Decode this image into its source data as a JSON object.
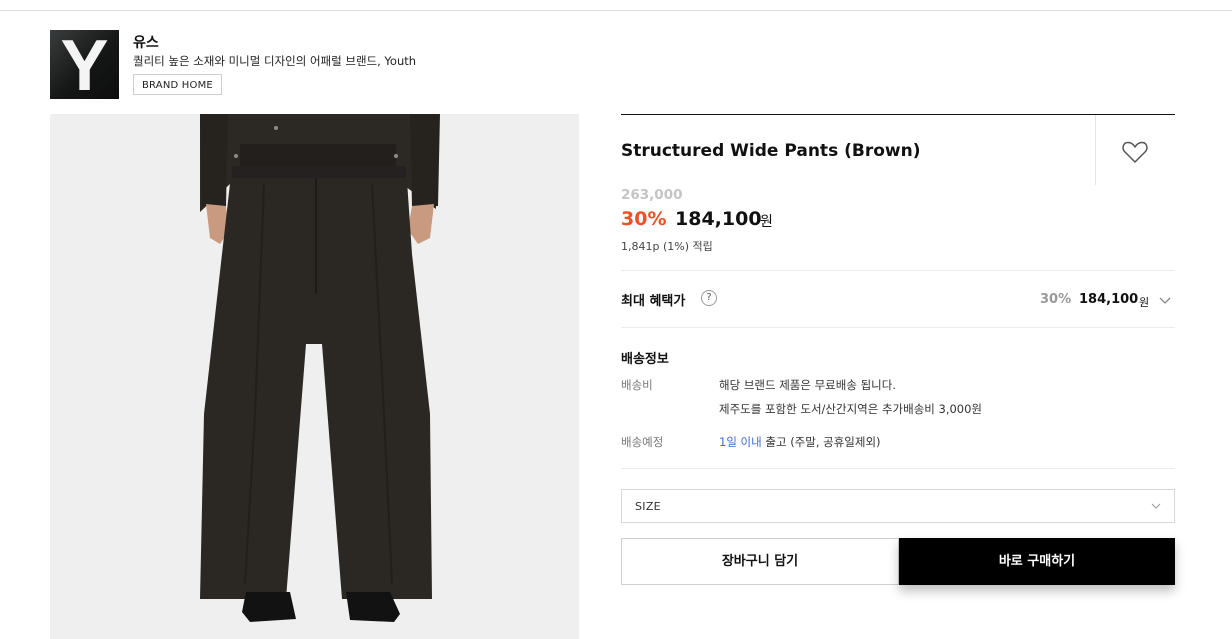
{
  "brand": {
    "logo_letter": "Y",
    "name": "유스",
    "description": "퀄리티 높은 소재와 미니멀 디자인의 어패럴 브랜드, Youth",
    "home_button": "BRAND HOME"
  },
  "product": {
    "name": "Structured Wide Pants (Brown)",
    "image_icon": "wide-pants-photo",
    "wishlist_icon": "heart-icon"
  },
  "price": {
    "original": "263,000",
    "discount_rate": "30%",
    "sale_price": "184,100",
    "currency": "원",
    "points": "1,841p (1%) 적립"
  },
  "max_benefit": {
    "label": "최대 혜택가",
    "help": "?",
    "rate": "30%",
    "price": "184,100",
    "currency": "원"
  },
  "shipping": {
    "title": "배송정보",
    "fee_label": "배송비",
    "fee_line1": "해당 브랜드 제품은 무료배송 됩니다.",
    "fee_line2": "제주도를 포함한 도서/산간지역은 추가배송비 3,000원",
    "schedule_label": "배송예정",
    "schedule_highlight": "1일 이내",
    "schedule_rest": " 출고 (주말, 공휴일제외)"
  },
  "options": {
    "size_placeholder": "SIZE"
  },
  "actions": {
    "cart": "장바구니 담기",
    "buy": "바로 구매하기"
  },
  "colors": {
    "accent": "#f05022",
    "link": "#3d6be5",
    "buy_bg": "#000000"
  }
}
